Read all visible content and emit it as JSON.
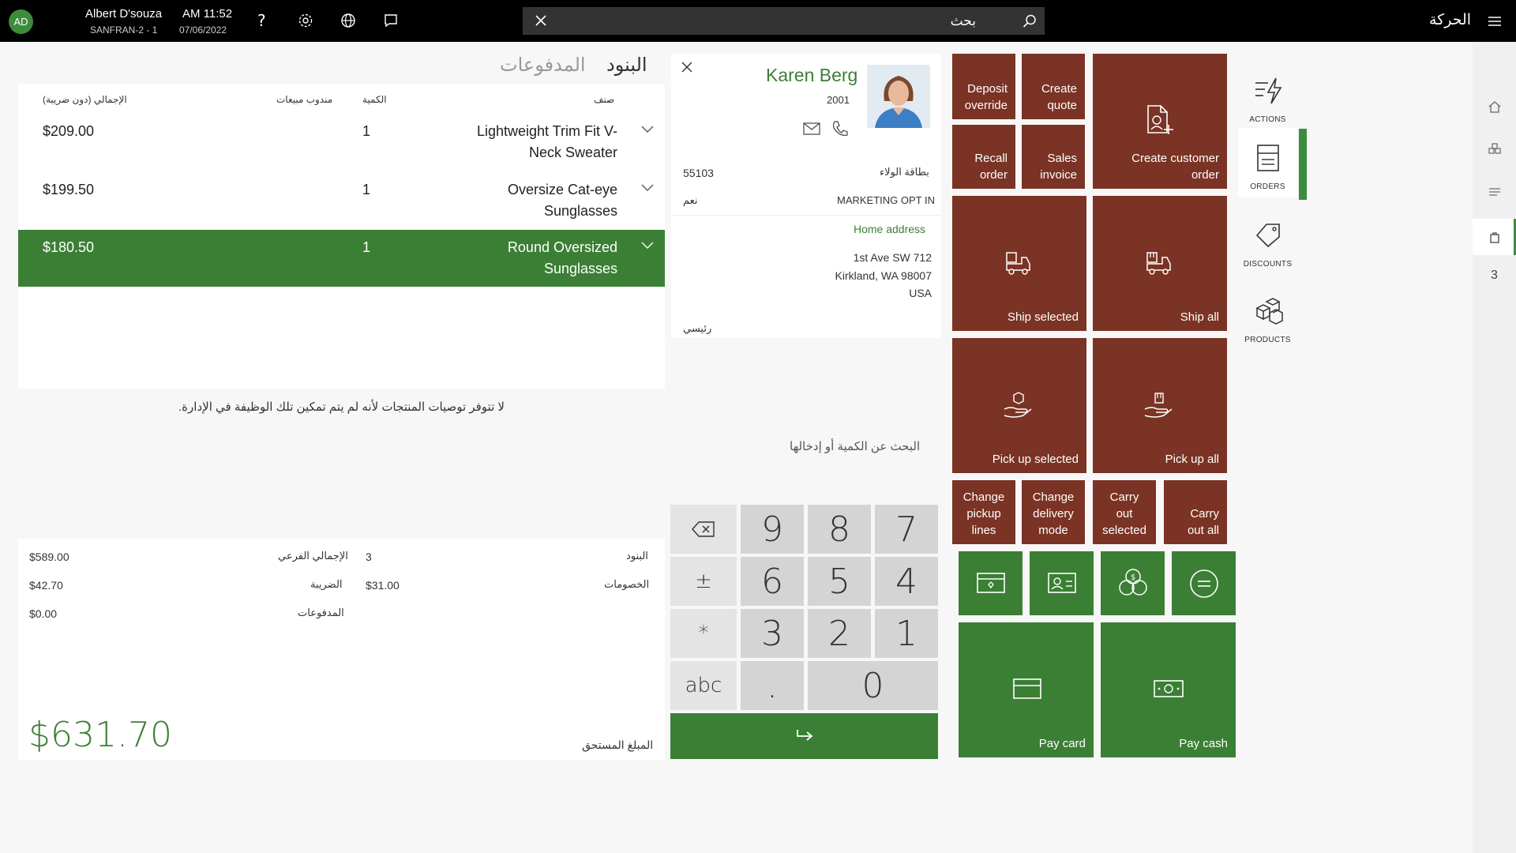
{
  "topbar": {
    "avatar_initials": "AD",
    "user_name": "Albert D'souza",
    "register": "SANFRAN-2 - 1",
    "time": "AM 11:52",
    "date": "07/06/2022",
    "search_placeholder": "بحث",
    "transaction_title": "الحركة"
  },
  "rail": {
    "cart_count": "3"
  },
  "side_menu": [
    {
      "label": "ACTIONS",
      "icon": "actions-icon"
    },
    {
      "label": "ORDERS",
      "icon": "orders-icon"
    },
    {
      "label": "DISCOUNTS",
      "icon": "discounts-icon"
    },
    {
      "label": "PRODUCTS",
      "icon": "products-icon"
    }
  ],
  "tabs": {
    "lines": "البنود",
    "payments": "المدفوعات"
  },
  "table": {
    "headers": {
      "item": "صنف",
      "quantity": "الكمية",
      "sales_rep": "مندوب مبيعات",
      "total_excl_tax": "الإجمالي (دون ضريبة)"
    },
    "rows": [
      {
        "name_line1": "Lightweight Trim Fit V-",
        "name_line2": "Neck Sweater",
        "qty": "1",
        "price": "$209.00",
        "selected": false
      },
      {
        "name_line1": "Oversize Cat-eye",
        "name_line2": "Sunglasses",
        "qty": "1",
        "price": "$199.50",
        "selected": false
      },
      {
        "name_line1": "Round Oversized",
        "name_line2": "Sunglasses",
        "qty": "1",
        "price": "$180.50",
        "selected": true
      }
    ],
    "recommendations_note": "لا تتوفر توصيات المنتجات لأنه لم يتم تمكين تلك الوظيفة في الإدارة."
  },
  "totals": {
    "lines_label": "البنود",
    "lines_value": "3",
    "subtotal_label": "الإجمالي الفرعي",
    "subtotal_value": "$589.00",
    "discounts_label": "الخصومات",
    "discounts_value": "$31.00",
    "tax_label": "الضريبة",
    "tax_value": "$42.70",
    "payments_label": "المدفوعات",
    "payments_value": "$0.00",
    "amount_due_label": "المبلغ المستحق",
    "amount_due_value": "$631.70"
  },
  "customer": {
    "name": "Karen Berg",
    "account": "2001",
    "loyalty_label": "بطاقة الولاء",
    "loyalty_value": "55103",
    "marketing_label": "MARKETING OPT IN",
    "marketing_value": "نعم",
    "address_title": "Home address",
    "address_line1": "1st Ave SW 712",
    "address_line2": "Kirkland, WA 98007",
    "address_line3": "USA",
    "address_type": "رئيسي"
  },
  "numpad": {
    "placeholder": "البحث عن الكمية أو إدخالها",
    "keys": {
      "k7": "7",
      "k8": "8",
      "k9": "9",
      "k4": "4",
      "k5": "5",
      "k6": "6",
      "k1": "1",
      "k2": "2",
      "k3": "3",
      "k0": "0",
      "dot": ".",
      "plusminus": "±",
      "star": "*",
      "abc": "abc"
    }
  },
  "tiles": {
    "deposit_override": "Deposit override",
    "create_quote": "Create quote",
    "create_customer_order": "Create customer order",
    "recall_order": "Recall order",
    "sales_invoice": "Sales invoice",
    "ship_selected": "Ship selected",
    "ship_all": "Ship all",
    "pick_up_selected": "Pick up selected",
    "pick_up_all": "Pick up all",
    "change_pickup_lines": "Change pickup lines",
    "change_delivery_mode": "Change delivery mode",
    "carry_out_selected": "Carry out selected",
    "carry_out_all": "Carry out all",
    "pay_card": "Pay card",
    "pay_cash": "Pay cash"
  },
  "colors": {
    "brown_tile": "#7a3324",
    "green_tile": "#3b7f35",
    "accent_green": "#3d8b3d"
  }
}
